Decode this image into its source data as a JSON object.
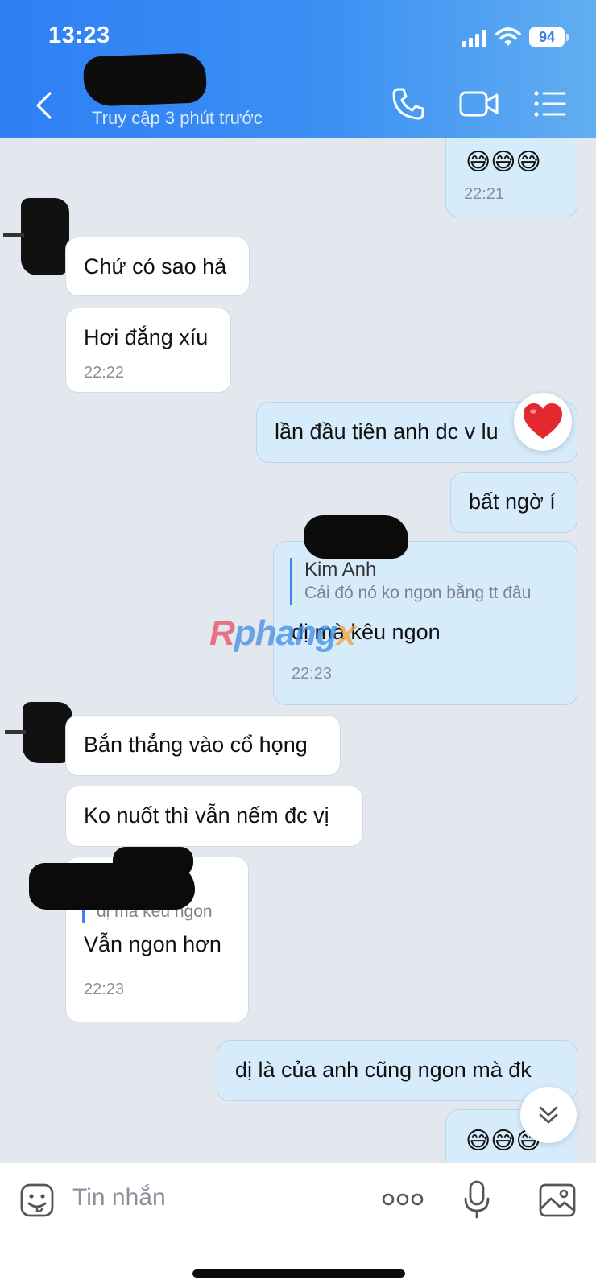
{
  "status_bar": {
    "time": "13:23",
    "battery": "94"
  },
  "header": {
    "last_seen": "Truy cập 3 phút trước"
  },
  "messages": {
    "m1": {
      "emoji": "😅😅😅",
      "time": "22:21"
    },
    "m2": {
      "text": "Chứ có sao hả"
    },
    "m3": {
      "text": "Hơi đắng xíu",
      "time": "22:22"
    },
    "m4": {
      "text": "lần đầu tiên anh dc v lu",
      "reaction": "❤️"
    },
    "m5": {
      "text": "bất ngờ í"
    },
    "m6": {
      "reply_author": "Kim Anh",
      "reply_text": "Cái đó nó ko ngon bằng tt đâu",
      "text": "dị mà kêu ngon",
      "time": "22:23"
    },
    "m7": {
      "text": "Bắn thẳng vào cổ họng"
    },
    "m8": {
      "text": "Ko nuốt thì vẫn nếm đc vị"
    },
    "m9": {
      "reply_text": "dị mà kêu ngon",
      "text": "Vẫn ngon hơn",
      "time": "22:23"
    },
    "m10": {
      "text": "dị là của anh cũng ngon mà đk"
    },
    "m11": {
      "emoji": "😅😅😅"
    }
  },
  "watermark": {
    "part1": "R",
    "part2": "phang",
    "part3": "x"
  },
  "input": {
    "placeholder": "Tin nhắn"
  },
  "colors": {
    "header_start": "#2f7ff5",
    "header_end": "#62aef1",
    "out_bubble": "#d6ecfb",
    "in_bubble": "#ffffff",
    "chat_bg": "#e3e7ee"
  }
}
